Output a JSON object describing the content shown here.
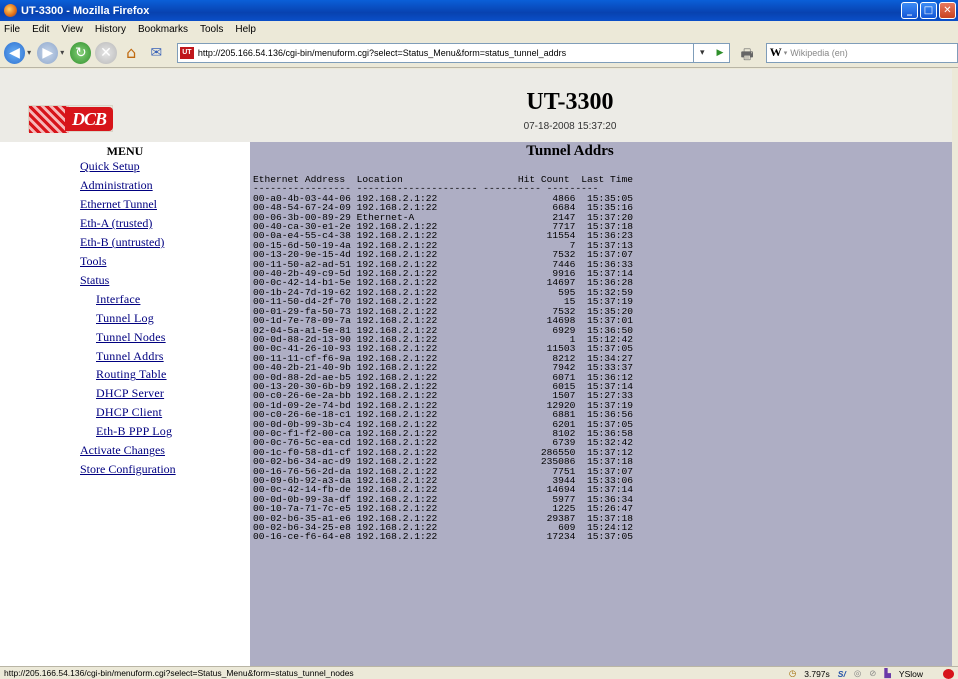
{
  "window": {
    "title": "UT-3300 - Mozilla Firefox"
  },
  "menubar": [
    "File",
    "Edit",
    "View",
    "History",
    "Bookmarks",
    "Tools",
    "Help"
  ],
  "navbar": {
    "url": "http://205.166.54.136/cgi-bin/menuform.cgi?select=Status_Menu&form=status_tunnel_addrs",
    "search_placeholder": "Wikipedia (en)",
    "search_engine": "W"
  },
  "header": {
    "logo_text": "DCB",
    "device_name": "UT-3300",
    "datetime": "07-18-2008 15:37:20"
  },
  "menu": {
    "title": "MENU",
    "items": [
      {
        "label": "Quick Setup",
        "level": 0
      },
      {
        "label": "Administration",
        "level": 0
      },
      {
        "label": "Ethernet Tunnel",
        "level": 0
      },
      {
        "label": "Eth-A (trusted)",
        "level": 0
      },
      {
        "label": "Eth-B (untrusted)",
        "level": 0
      },
      {
        "label": "Tools",
        "level": 0
      },
      {
        "label": "Status",
        "level": 0
      },
      {
        "label": "Interface",
        "level": 1
      },
      {
        "label": "Tunnel Log",
        "level": 1
      },
      {
        "label": "Tunnel Nodes",
        "level": 1
      },
      {
        "label": "Tunnel Addrs",
        "level": 1
      },
      {
        "label": "Routing Table",
        "level": 1
      },
      {
        "label": "DHCP Server",
        "level": 1
      },
      {
        "label": "DHCP Client",
        "level": 1
      },
      {
        "label": "Eth-B PPP Log",
        "level": 1
      },
      {
        "label": "Activate Changes",
        "level": 0
      },
      {
        "label": "Store Configuration",
        "level": 0
      }
    ]
  },
  "main": {
    "title": "Tunnel Addrs",
    "columns": [
      "Ethernet Address",
      "Location",
      "Hit Count",
      "Last Time"
    ],
    "rows": [
      [
        "00-a0-4b-03-44-06",
        "192.168.2.1:22",
        "4866",
        "15:35:05"
      ],
      [
        "00-48-54-67-24-09",
        "192.168.2.1:22",
        "6684",
        "15:35:16"
      ],
      [
        "00-06-3b-00-89-29",
        "Ethernet-A",
        "2147",
        "15:37:20"
      ],
      [
        "00-40-ca-30-e1-2e",
        "192.168.2.1:22",
        "7717",
        "15:37:18"
      ],
      [
        "00-0a-e4-55-c4-38",
        "192.168.2.1:22",
        "11554",
        "15:36:23"
      ],
      [
        "00-15-6d-50-19-4a",
        "192.168.2.1:22",
        "7",
        "15:37:13"
      ],
      [
        "00-13-20-9e-15-4d",
        "192.168.2.1:22",
        "7532",
        "15:37:07"
      ],
      [
        "00-11-50-a2-ad-51",
        "192.168.2.1:22",
        "7446",
        "15:36:33"
      ],
      [
        "00-40-2b-49-c9-5d",
        "192.168.2.1:22",
        "9916",
        "15:37:14"
      ],
      [
        "00-0c-42-14-b1-5e",
        "192.168.2.1:22",
        "14697",
        "15:36:28"
      ],
      [
        "00-1b-24-7d-19-62",
        "192.168.2.1:22",
        "595",
        "15:32:59"
      ],
      [
        "00-11-50-d4-2f-70",
        "192.168.2.1:22",
        "15",
        "15:37:19"
      ],
      [
        "00-01-29-fa-50-73",
        "192.168.2.1:22",
        "7532",
        "15:35:20"
      ],
      [
        "00-1d-7e-78-09-7a",
        "192.168.2.1:22",
        "14698",
        "15:37:01"
      ],
      [
        "02-04-5a-a1-5e-81",
        "192.168.2.1:22",
        "6929",
        "15:36:50"
      ],
      [
        "00-0d-88-2d-13-90",
        "192.168.2.1:22",
        "1",
        "15:12:42"
      ],
      [
        "00-0c-41-26-10-93",
        "192.168.2.1:22",
        "11503",
        "15:37:05"
      ],
      [
        "00-11-11-cf-f6-9a",
        "192.168.2.1:22",
        "8212",
        "15:34:27"
      ],
      [
        "00-40-2b-21-40-9b",
        "192.168.2.1:22",
        "7942",
        "15:33:37"
      ],
      [
        "00-0d-88-2d-ae-b5",
        "192.168.2.1:22",
        "6071",
        "15:36:12"
      ],
      [
        "00-13-20-30-6b-b9",
        "192.168.2.1:22",
        "6015",
        "15:37:14"
      ],
      [
        "00-c0-26-6e-2a-bb",
        "192.168.2.1:22",
        "1507",
        "15:27:33"
      ],
      [
        "00-1d-09-2e-74-bd",
        "192.168.2.1:22",
        "12920",
        "15:37:19"
      ],
      [
        "00-c0-26-6e-18-c1",
        "192.168.2.1:22",
        "6881",
        "15:36:56"
      ],
      [
        "00-0d-0b-99-3b-c4",
        "192.168.2.1:22",
        "6201",
        "15:37:05"
      ],
      [
        "00-0c-f1-f2-00-ca",
        "192.168.2.1:22",
        "8102",
        "15:36:58"
      ],
      [
        "00-0c-76-5c-ea-cd",
        "192.168.2.1:22",
        "6739",
        "15:32:42"
      ],
      [
        "00-1c-f0-58-d1-cf",
        "192.168.2.1:22",
        "286550",
        "15:37:12"
      ],
      [
        "00-02-b6-34-ac-d9",
        "192.168.2.1:22",
        "235086",
        "15:37:18"
      ],
      [
        "00-16-76-56-2d-da",
        "192.168.2.1:22",
        "7751",
        "15:37:07"
      ],
      [
        "00-09-6b-92-a3-da",
        "192.168.2.1:22",
        "3944",
        "15:33:06"
      ],
      [
        "00-0c-42-14-fb-de",
        "192.168.2.1:22",
        "14694",
        "15:37:14"
      ],
      [
        "00-0d-0b-99-3a-df",
        "192.168.2.1:22",
        "5977",
        "15:36:34"
      ],
      [
        "00-10-7a-71-7c-e5",
        "192.168.2.1:22",
        "1225",
        "15:26:47"
      ],
      [
        "00-02-b6-35-a1-e6",
        "192.168.2.1:22",
        "29387",
        "15:37:18"
      ],
      [
        "00-02-b6-34-25-e8",
        "192.168.2.1:22",
        "609",
        "15:24:12"
      ],
      [
        "00-16-ce-f6-64-e8",
        "192.168.2.1:22",
        "17234",
        "15:37:05"
      ]
    ]
  },
  "statusbar": {
    "text": "http://205.166.54.136/cgi-bin/menuform.cgi?select=Status_Menu&form=status_tunnel_nodes",
    "timing": "3.797s",
    "yslow": "YSlow"
  }
}
